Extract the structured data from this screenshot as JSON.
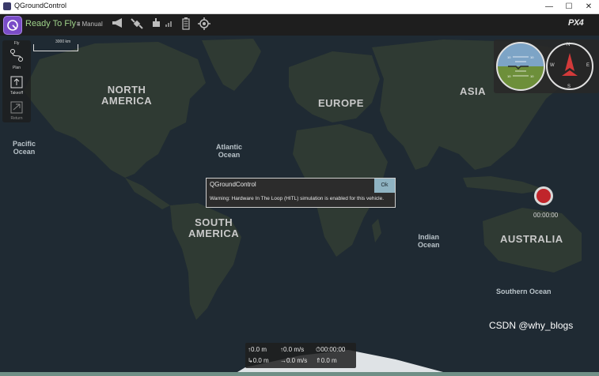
{
  "window": {
    "title": "QGroundControl",
    "minimize": "—",
    "maximize": "☐",
    "close": "✕"
  },
  "toolbar": {
    "status": "Ready To Fly",
    "flight_mode": "Manual",
    "brand": "PX4",
    "icons": [
      "qgc-logo-icon",
      "messages-megaphone-icon",
      "gps-satellite-icon",
      "rc-signal-icon",
      "battery-icon",
      "gimbal-target-icon"
    ]
  },
  "map": {
    "scale_label": "3000 km",
    "tools": {
      "fly_label": "Fly",
      "plan_label": "Plan",
      "takeoff_label": "Takeoff",
      "return_label": "Return"
    },
    "labels": {
      "north_america": "NORTH\nAMERICA",
      "europe": "EUROPE",
      "asia": "ASIA",
      "south_america": "SOUTH\nAMERICA",
      "australia": "AUSTRALIA",
      "pacific": "Pacific\nOcean",
      "atlantic": "Atlantic\nOcean",
      "indian": "Indian\nOcean",
      "southern": "Southern Ocean"
    },
    "compass": {
      "n": "N",
      "w": "W",
      "e": "E",
      "s": "S"
    },
    "attitude_ticks": [
      "10",
      "10",
      "10",
      "10"
    ]
  },
  "dialog": {
    "title": "QGroundControl",
    "ok_label": "Ok",
    "message": "Warning: Hardware In The Loop (HITL) simulation is enabled for this vehicle."
  },
  "recording": {
    "time": "00:00:00"
  },
  "telemetry": {
    "altitude": "↑0.0 m",
    "vertical_speed": "↑0.0 m/s",
    "flight_time": "⏱00:00:00",
    "distance": "↳0.0 m",
    "horizontal_speed": "→0.0 m/s",
    "home_distance": "⇑0.0 m"
  },
  "watermark": "CSDN @why_blogs",
  "colors": {
    "ready": "#9fd38a",
    "toolbar_bg": "#1e1e1e",
    "ok_button": "#8fb3c2",
    "record": "#c0252b"
  }
}
